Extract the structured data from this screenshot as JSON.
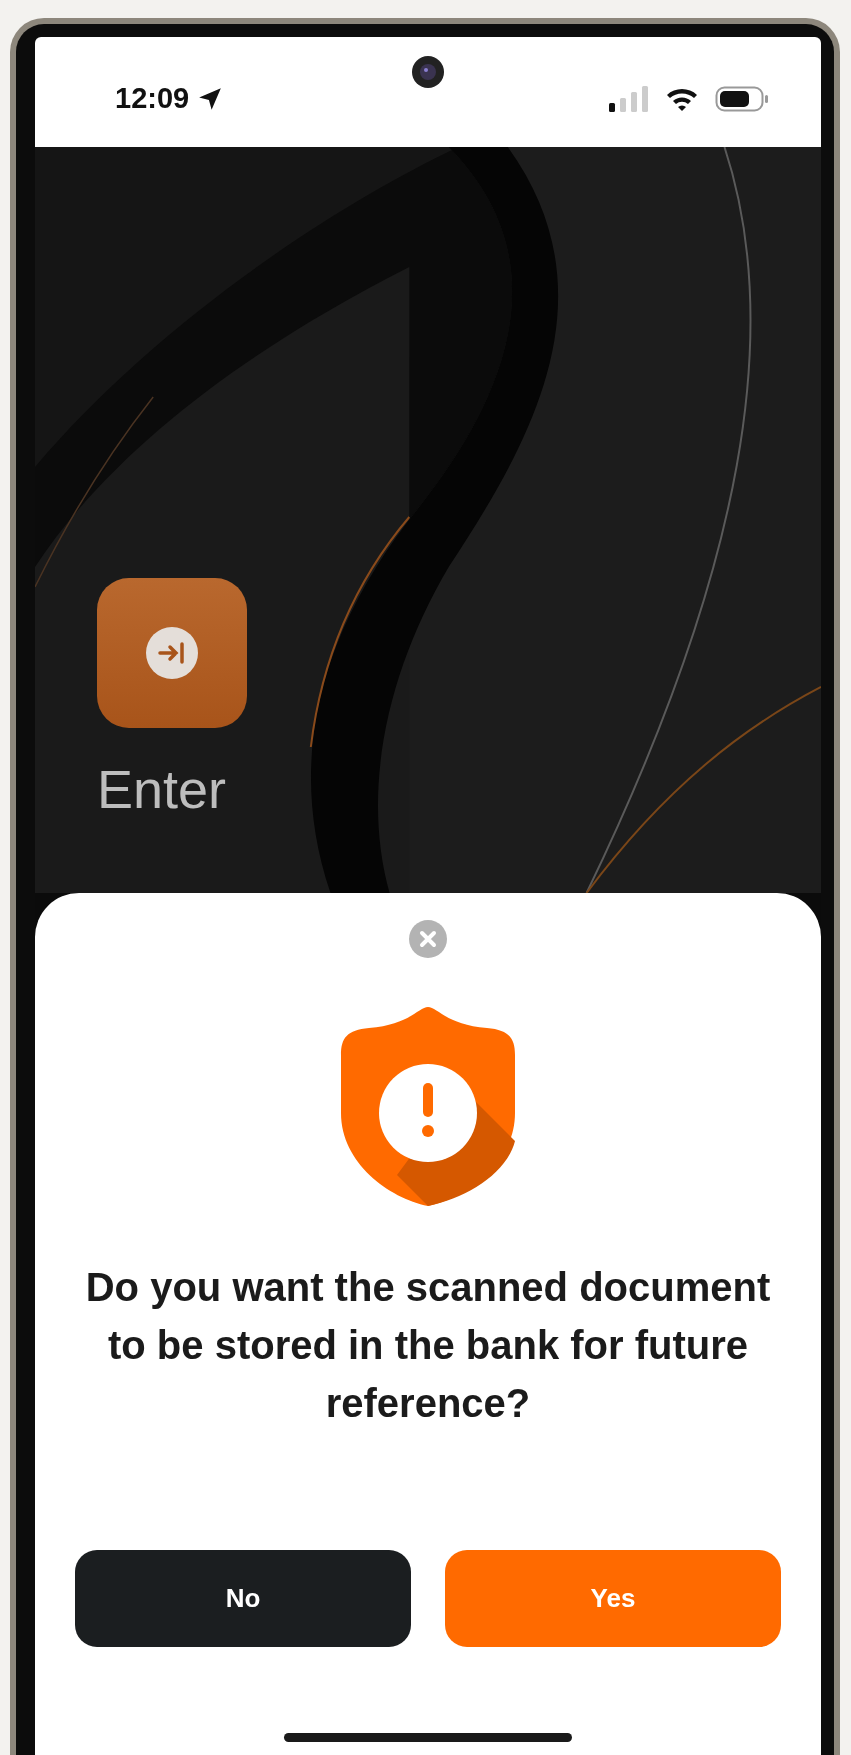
{
  "status_bar": {
    "time": "12:09"
  },
  "hero": {
    "title": "Enter"
  },
  "dialog": {
    "question": "Do you want the scanned document to be stored in the bank for future reference?",
    "buttons": [
      {
        "label": "No",
        "kind": "secondary"
      },
      {
        "label": "Yes",
        "kind": "primary"
      }
    ]
  }
}
